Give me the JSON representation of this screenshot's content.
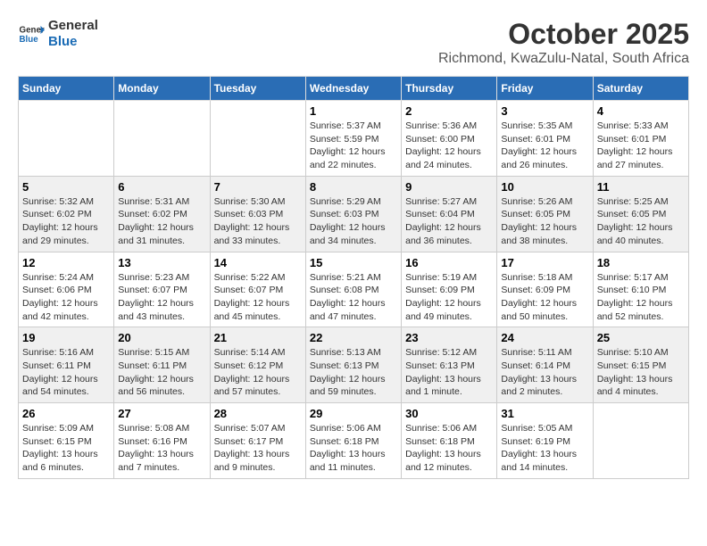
{
  "header": {
    "logo": {
      "line1": "General",
      "line2": "Blue"
    },
    "title": "October 2025",
    "subtitle": "Richmond, KwaZulu-Natal, South Africa"
  },
  "calendar": {
    "headers": [
      "Sunday",
      "Monday",
      "Tuesday",
      "Wednesday",
      "Thursday",
      "Friday",
      "Saturday"
    ],
    "weeks": [
      [
        {
          "day": "",
          "text": ""
        },
        {
          "day": "",
          "text": ""
        },
        {
          "day": "",
          "text": ""
        },
        {
          "day": "1",
          "text": "Sunrise: 5:37 AM\nSunset: 5:59 PM\nDaylight: 12 hours\nand 22 minutes."
        },
        {
          "day": "2",
          "text": "Sunrise: 5:36 AM\nSunset: 6:00 PM\nDaylight: 12 hours\nand 24 minutes."
        },
        {
          "day": "3",
          "text": "Sunrise: 5:35 AM\nSunset: 6:01 PM\nDaylight: 12 hours\nand 26 minutes."
        },
        {
          "day": "4",
          "text": "Sunrise: 5:33 AM\nSunset: 6:01 PM\nDaylight: 12 hours\nand 27 minutes."
        }
      ],
      [
        {
          "day": "5",
          "text": "Sunrise: 5:32 AM\nSunset: 6:02 PM\nDaylight: 12 hours\nand 29 minutes."
        },
        {
          "day": "6",
          "text": "Sunrise: 5:31 AM\nSunset: 6:02 PM\nDaylight: 12 hours\nand 31 minutes."
        },
        {
          "day": "7",
          "text": "Sunrise: 5:30 AM\nSunset: 6:03 PM\nDaylight: 12 hours\nand 33 minutes."
        },
        {
          "day": "8",
          "text": "Sunrise: 5:29 AM\nSunset: 6:03 PM\nDaylight: 12 hours\nand 34 minutes."
        },
        {
          "day": "9",
          "text": "Sunrise: 5:27 AM\nSunset: 6:04 PM\nDaylight: 12 hours\nand 36 minutes."
        },
        {
          "day": "10",
          "text": "Sunrise: 5:26 AM\nSunset: 6:05 PM\nDaylight: 12 hours\nand 38 minutes."
        },
        {
          "day": "11",
          "text": "Sunrise: 5:25 AM\nSunset: 6:05 PM\nDaylight: 12 hours\nand 40 minutes."
        }
      ],
      [
        {
          "day": "12",
          "text": "Sunrise: 5:24 AM\nSunset: 6:06 PM\nDaylight: 12 hours\nand 42 minutes."
        },
        {
          "day": "13",
          "text": "Sunrise: 5:23 AM\nSunset: 6:07 PM\nDaylight: 12 hours\nand 43 minutes."
        },
        {
          "day": "14",
          "text": "Sunrise: 5:22 AM\nSunset: 6:07 PM\nDaylight: 12 hours\nand 45 minutes."
        },
        {
          "day": "15",
          "text": "Sunrise: 5:21 AM\nSunset: 6:08 PM\nDaylight: 12 hours\nand 47 minutes."
        },
        {
          "day": "16",
          "text": "Sunrise: 5:19 AM\nSunset: 6:09 PM\nDaylight: 12 hours\nand 49 minutes."
        },
        {
          "day": "17",
          "text": "Sunrise: 5:18 AM\nSunset: 6:09 PM\nDaylight: 12 hours\nand 50 minutes."
        },
        {
          "day": "18",
          "text": "Sunrise: 5:17 AM\nSunset: 6:10 PM\nDaylight: 12 hours\nand 52 minutes."
        }
      ],
      [
        {
          "day": "19",
          "text": "Sunrise: 5:16 AM\nSunset: 6:11 PM\nDaylight: 12 hours\nand 54 minutes."
        },
        {
          "day": "20",
          "text": "Sunrise: 5:15 AM\nSunset: 6:11 PM\nDaylight: 12 hours\nand 56 minutes."
        },
        {
          "day": "21",
          "text": "Sunrise: 5:14 AM\nSunset: 6:12 PM\nDaylight: 12 hours\nand 57 minutes."
        },
        {
          "day": "22",
          "text": "Sunrise: 5:13 AM\nSunset: 6:13 PM\nDaylight: 12 hours\nand 59 minutes."
        },
        {
          "day": "23",
          "text": "Sunrise: 5:12 AM\nSunset: 6:13 PM\nDaylight: 13 hours\nand 1 minute."
        },
        {
          "day": "24",
          "text": "Sunrise: 5:11 AM\nSunset: 6:14 PM\nDaylight: 13 hours\nand 2 minutes."
        },
        {
          "day": "25",
          "text": "Sunrise: 5:10 AM\nSunset: 6:15 PM\nDaylight: 13 hours\nand 4 minutes."
        }
      ],
      [
        {
          "day": "26",
          "text": "Sunrise: 5:09 AM\nSunset: 6:15 PM\nDaylight: 13 hours\nand 6 minutes."
        },
        {
          "day": "27",
          "text": "Sunrise: 5:08 AM\nSunset: 6:16 PM\nDaylight: 13 hours\nand 7 minutes."
        },
        {
          "day": "28",
          "text": "Sunrise: 5:07 AM\nSunset: 6:17 PM\nDaylight: 13 hours\nand 9 minutes."
        },
        {
          "day": "29",
          "text": "Sunrise: 5:06 AM\nSunset: 6:18 PM\nDaylight: 13 hours\nand 11 minutes."
        },
        {
          "day": "30",
          "text": "Sunrise: 5:06 AM\nSunset: 6:18 PM\nDaylight: 13 hours\nand 12 minutes."
        },
        {
          "day": "31",
          "text": "Sunrise: 5:05 AM\nSunset: 6:19 PM\nDaylight: 13 hours\nand 14 minutes."
        },
        {
          "day": "",
          "text": ""
        }
      ]
    ]
  }
}
